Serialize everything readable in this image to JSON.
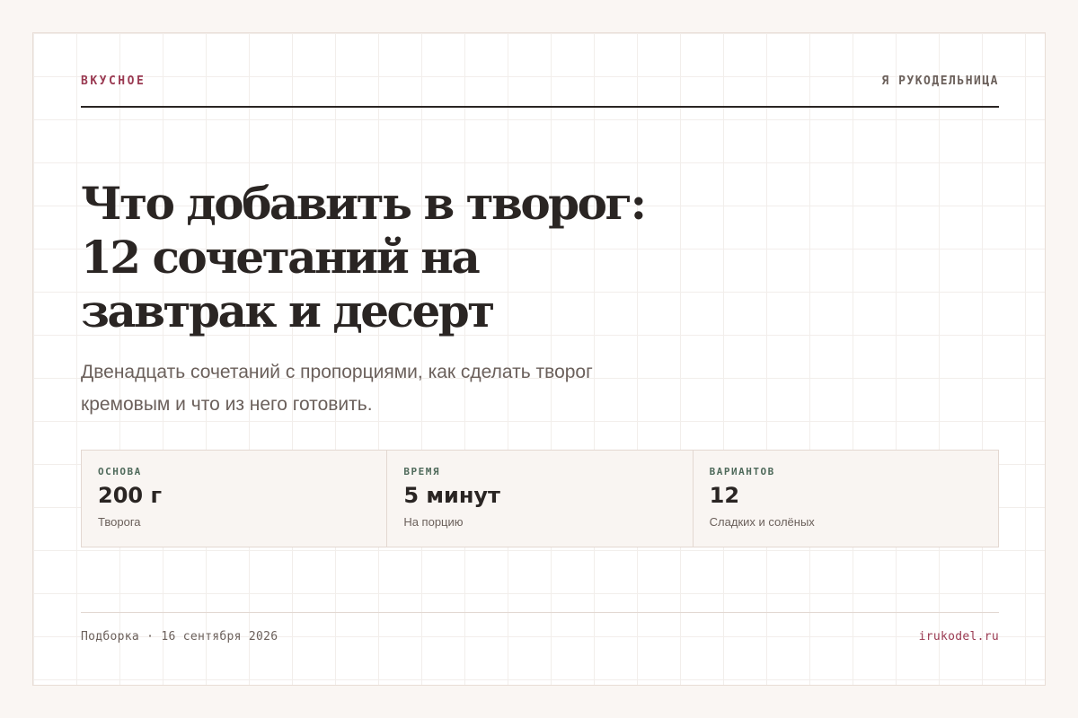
{
  "header": {
    "category": "ВКУСНОЕ",
    "site_name": "Я РУКОДЕЛЬНИЦА"
  },
  "article": {
    "title": "Что добавить в творог: 12 сочетаний на завтрак и десерт",
    "subtitle": "Двенадцать сочетаний с пропорциями, как сделать творог кремовым и что из него готовить."
  },
  "stats": [
    {
      "label": "ОСНОВА",
      "value": "200 г",
      "sub": "Творога"
    },
    {
      "label": "ВРЕМЯ",
      "value": "5 минут",
      "sub": "На порцию"
    },
    {
      "label": "ВАРИАНТОВ",
      "value": "12",
      "sub": "Сладких и солёных"
    }
  ],
  "footer": {
    "meta": "Подборка · 16 сентября 2026",
    "domain": "irukodel.ru"
  },
  "colors": {
    "accent": "#9a3a52",
    "label_green": "#4f6a5b",
    "text_dark": "#2a2523",
    "text_muted": "#6b605b",
    "background": "#faf6f3"
  }
}
